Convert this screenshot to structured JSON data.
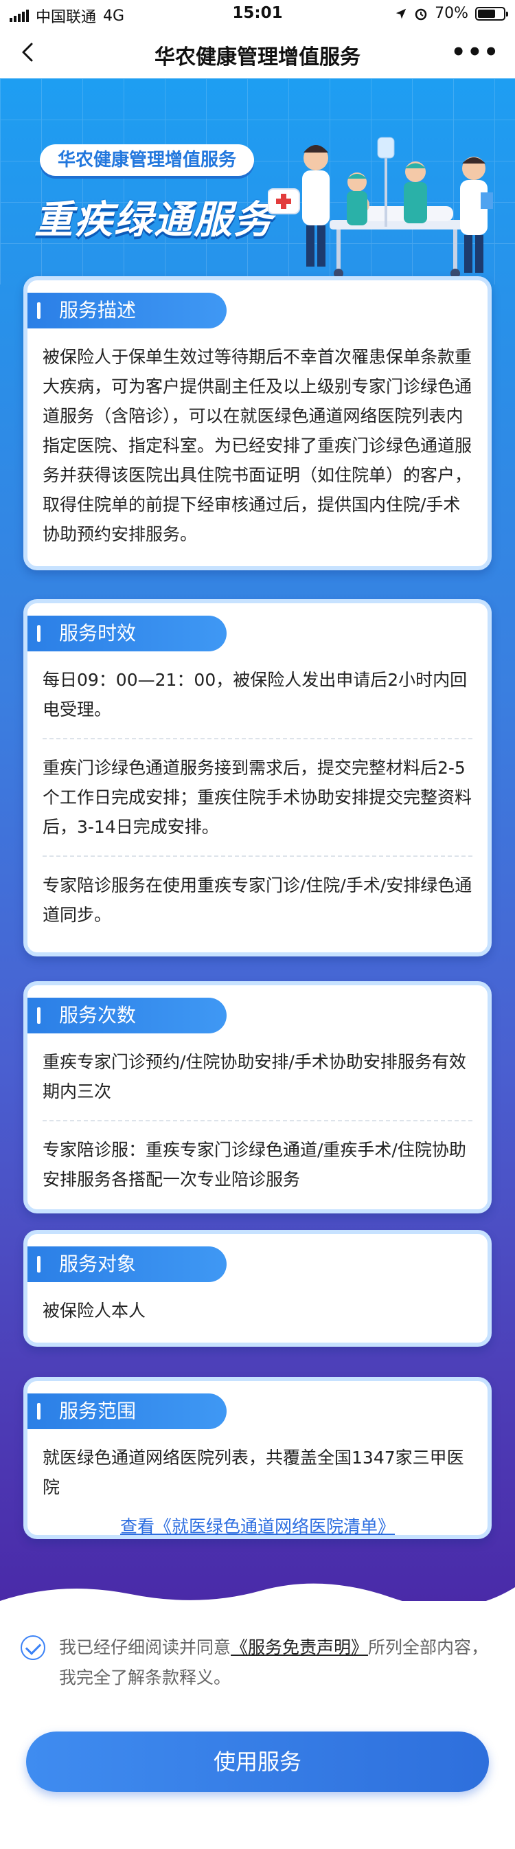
{
  "status_bar": {
    "carrier": "中国联通",
    "network": "4G",
    "time": "15:01",
    "battery": "70%",
    "battery_level": 0.7
  },
  "nav": {
    "title": "华农健康管理增值服务",
    "back_icon": "chevron-left-icon",
    "more_icon": "more-dots-icon",
    "more_glyph": "•••"
  },
  "hero": {
    "badge": "华农健康管理增值服务",
    "title": "重疾绿通服务"
  },
  "sections": {
    "description": {
      "heading": "服务描述",
      "paragraphs": [
        "被保险人于保单生效过等待期后不幸首次罹患保单条款重大疾病，可为客户提供副主任及以上级别专家门诊绿色通道服务（含陪诊），可以在就医绿色通道网络医院列表内指定医院、指定科室。为已经安排了重疾门诊绿色通道服务并获得该医院出具住院书面证明（如住院单）的客户，取得住院单的前提下经审核通过后，提供国内住院/手术协助预约安排服务。"
      ]
    },
    "timeliness": {
      "heading": "服务时效",
      "paragraphs": [
        "每日09：00—21：00，被保险人发出申请后2小时内回电受理。",
        "重疾门诊绿色通道服务接到需求后，提交完整材料后2-5个工作日完成安排；重疾住院手术协助安排提交完整资料后，3-14日完成安排。",
        "专家陪诊服务在使用重疾专家门诊/住院/手术/安排绿色通道同步。"
      ]
    },
    "count": {
      "heading": "服务次数",
      "paragraphs": [
        "重疾专家门诊预约/住院协助安排/手术协助安排服务有效期内三次",
        "专家陪诊服：重疾专家门诊绿色通道/重疾手术/住院协助安排服务各搭配一次专业陪诊服务"
      ]
    },
    "target": {
      "heading": "服务对象",
      "paragraphs": [
        "被保险人本人"
      ]
    },
    "scope": {
      "heading": "服务范围",
      "paragraphs": [
        "就医绿色通道网络医院列表，共覆盖全国1347家三甲医院"
      ],
      "link": "查看《就医绿色通道网络医院清单》"
    }
  },
  "agreement": {
    "prefix": "我已经仔细阅读并同意",
    "link": "《服务免责声明》",
    "suffix": "所列全部内容，我完全了解条款释义。",
    "checked": true
  },
  "use_button": "使用服务",
  "colors": {
    "primary": "#2e6fdc",
    "bg_top": "#1e9ef2",
    "bg_bottom": "#4a2aa8",
    "card_border": "#c7e2ff"
  }
}
